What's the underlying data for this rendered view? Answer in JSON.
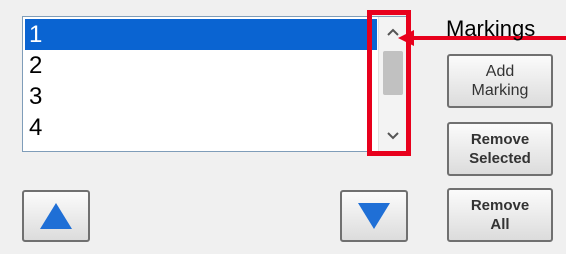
{
  "list": {
    "items": [
      "1",
      "2",
      "3",
      "4"
    ],
    "selected_index": 0
  },
  "markings_panel": {
    "title": "Markings",
    "add_label": "Add\nMarking",
    "remove_selected_label": "Remove\nSelected",
    "remove_all_label": "Remove\nAll"
  },
  "icons": {
    "scroll_up": "chevron-up-icon",
    "scroll_down": "chevron-down-icon",
    "move_up": "triangle-up-icon",
    "move_down": "triangle-down-icon"
  },
  "colors": {
    "selection": "#0a64d2",
    "highlight": "#e8001c",
    "nav_triangle": "#1f6fd6"
  }
}
